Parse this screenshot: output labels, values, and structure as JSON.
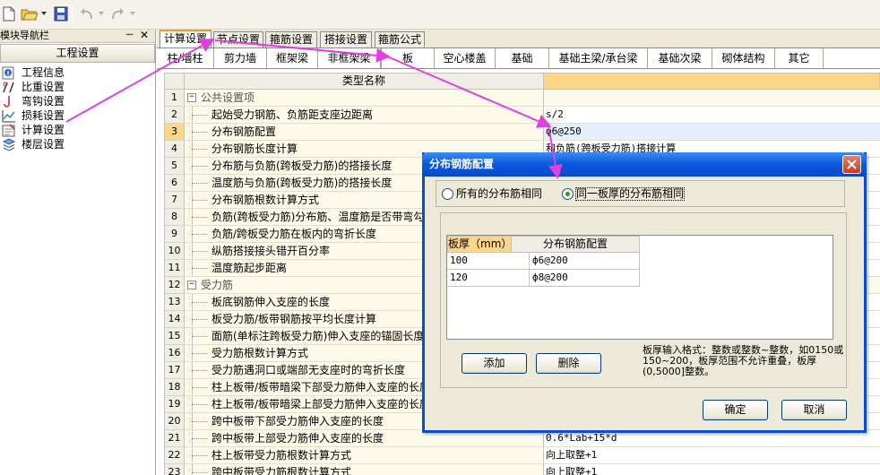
{
  "colors": {
    "annotation_arrow": "#e040e0",
    "dialog_title_bg": "#0b5be0",
    "active_tab_border": "#e8a132",
    "header_highlight": "#fbd68a"
  },
  "toolbar": {
    "icons": [
      "new-file-icon",
      "open-folder-icon",
      "save-icon",
      "undo-icon",
      "redo-icon"
    ]
  },
  "left_panel": {
    "title": "模块导航栏",
    "pin": "ᅲ",
    "close": "✕",
    "header": "工程设置",
    "items": [
      {
        "label": "工程信息",
        "icon": "info-icon"
      },
      {
        "label": "比重设置",
        "icon": "ratio-icon"
      },
      {
        "label": "弯钩设置",
        "icon": "hook-icon"
      },
      {
        "label": "损耗设置",
        "icon": "chart-icon"
      },
      {
        "label": "计算设置",
        "icon": "calc-settings-icon"
      },
      {
        "label": "楼层设置",
        "icon": "floors-icon"
      }
    ]
  },
  "outer_tabs": [
    "计算设置",
    "节点设置",
    "箍筋设置",
    "搭接设置",
    "箍筋公式"
  ],
  "inner_tabs": [
    "柱/墙柱",
    "剪力墙",
    "框架梁",
    "非框架梁",
    "板",
    "空心楼盖",
    "基础",
    "基础主梁/承台梁",
    "基础次梁",
    "砌体结构",
    "其它"
  ],
  "grid": {
    "header_name": "类型名称",
    "rows": [
      {
        "num": "1",
        "name": "公共设置项",
        "value": "",
        "group": true
      },
      {
        "num": "2",
        "name": "起始受力钢筋、负筋距支座边距离",
        "value": "s/2"
      },
      {
        "num": "3",
        "name": "分布钢筋配置",
        "value": "ф6@250",
        "selected": true
      },
      {
        "num": "4",
        "name": "分布钢筋长度计算",
        "value": "和负筋(跨板受力筋)搭接计算"
      },
      {
        "num": "5",
        "name": "分布筋与负筋(跨板受力筋)的搭接长度",
        "value": ""
      },
      {
        "num": "6",
        "name": "温度筋与负筋(跨板受力筋)的搭接长度",
        "value": ""
      },
      {
        "num": "7",
        "name": "分布钢筋根数计算方式",
        "value": ""
      },
      {
        "num": "8",
        "name": "负筋(跨板受力筋)分布筋、温度筋是否带弯勾",
        "value": ""
      },
      {
        "num": "9",
        "name": "负筋/跨板受力筋在板内的弯折长度",
        "value": ""
      },
      {
        "num": "10",
        "name": "纵筋搭接接头错开百分率",
        "value": ""
      },
      {
        "num": "11",
        "name": "温度筋起步距离",
        "value": ""
      },
      {
        "num": "12",
        "name": "受力筋",
        "value": "",
        "group": true
      },
      {
        "num": "13",
        "name": "板底钢筋伸入支座的长度",
        "value": ""
      },
      {
        "num": "14",
        "name": "板受力筋/板带钢筋按平均长度计算",
        "value": ""
      },
      {
        "num": "15",
        "name": "面筋(单标注跨板受力筋)伸入支座的锚固长度",
        "value": ""
      },
      {
        "num": "16",
        "name": "受力筋根数计算方式",
        "value": ""
      },
      {
        "num": "17",
        "name": "受力筋遇洞口或端部无支座时的弯折长度",
        "value": ""
      },
      {
        "num": "18",
        "name": "柱上板带/板带暗梁下部受力筋伸入支座的长度",
        "value": ""
      },
      {
        "num": "19",
        "name": "柱上板带/板带暗梁上部受力筋伸入支座的长度",
        "value": ""
      },
      {
        "num": "20",
        "name": "跨中板带下部受力筋伸入支座的长度",
        "value": ""
      },
      {
        "num": "21",
        "name": "跨中板带上部受力筋伸入支座的长度",
        "value": "0.6*Lab+15*d"
      },
      {
        "num": "22",
        "name": "柱上板带受力筋根数计算方式",
        "value": "向上取整+1"
      },
      {
        "num": "23",
        "name": "跨中板带受力筋根数计算方式",
        "value": "向上取整+1"
      }
    ]
  },
  "dialog": {
    "title": "分布钢筋配置",
    "radio_all_same": "所有的分布筋相同",
    "radio_same_thickness": "同一板厚的分布筋相同",
    "selected_option": "同一板厚的分布筋相同",
    "table": {
      "headers": [
        "板厚（mm）",
        "分布钢筋配置"
      ],
      "rows": [
        [
          "100",
          "ф6@200"
        ],
        [
          "120",
          "ф8@200"
        ]
      ]
    },
    "add_button": "添加",
    "delete_button": "删除",
    "hint": "板厚输入格式：整数或整数~整数，如0150或150~200，板厚范围不允许重叠，板厚(0,5000]整数。",
    "ok_button": "确定",
    "cancel_button": "取消"
  }
}
